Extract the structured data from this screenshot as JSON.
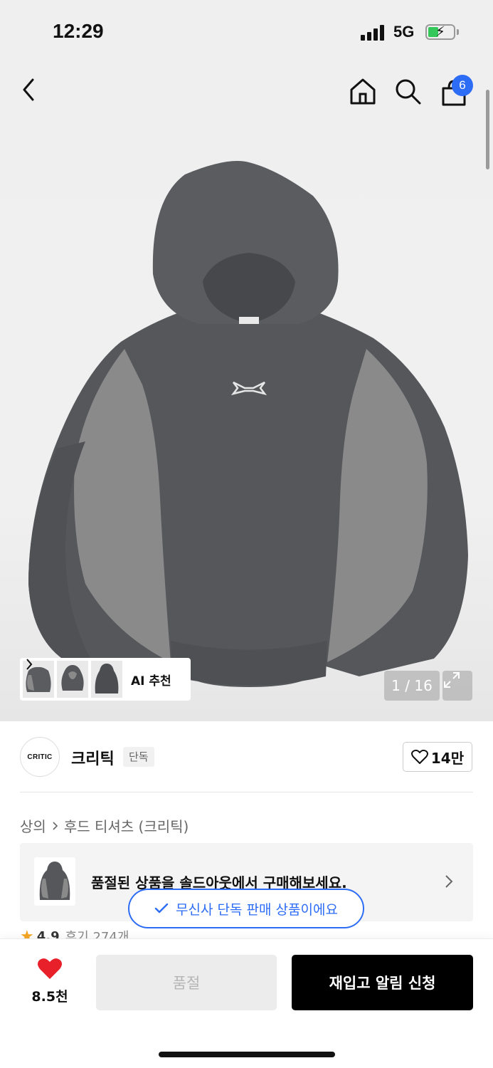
{
  "status_bar": {
    "time": "12:29",
    "network": "5G"
  },
  "header": {
    "cart_count": "6"
  },
  "gallery": {
    "ai_label": "AI 추천",
    "counter": "1 / 16"
  },
  "brand": {
    "logo_text": "CRITIC",
    "name": "크리틱",
    "tag": "단독",
    "likes": "14만"
  },
  "breadcrumb": {
    "category": "상의",
    "subcategory": "후드 티셔츠 (크리틱)"
  },
  "soldout_card": {
    "text": "품절된 상품을 솔드아웃에서 구매해보세요."
  },
  "toast": {
    "text": "무신사 단독 판매 상품이에요"
  },
  "rating": {
    "score": "4.9",
    "reviews": "후기 274개"
  },
  "bottom": {
    "fav_count": "8.5천",
    "soldout_label": "품절",
    "restock_label": "재입고 알림 신청"
  },
  "colors": {
    "accent": "#2d6cf5",
    "heart": "#e8202a",
    "hoodie_dark": "#55575b",
    "hoodie_light": "#8a8a8b"
  }
}
